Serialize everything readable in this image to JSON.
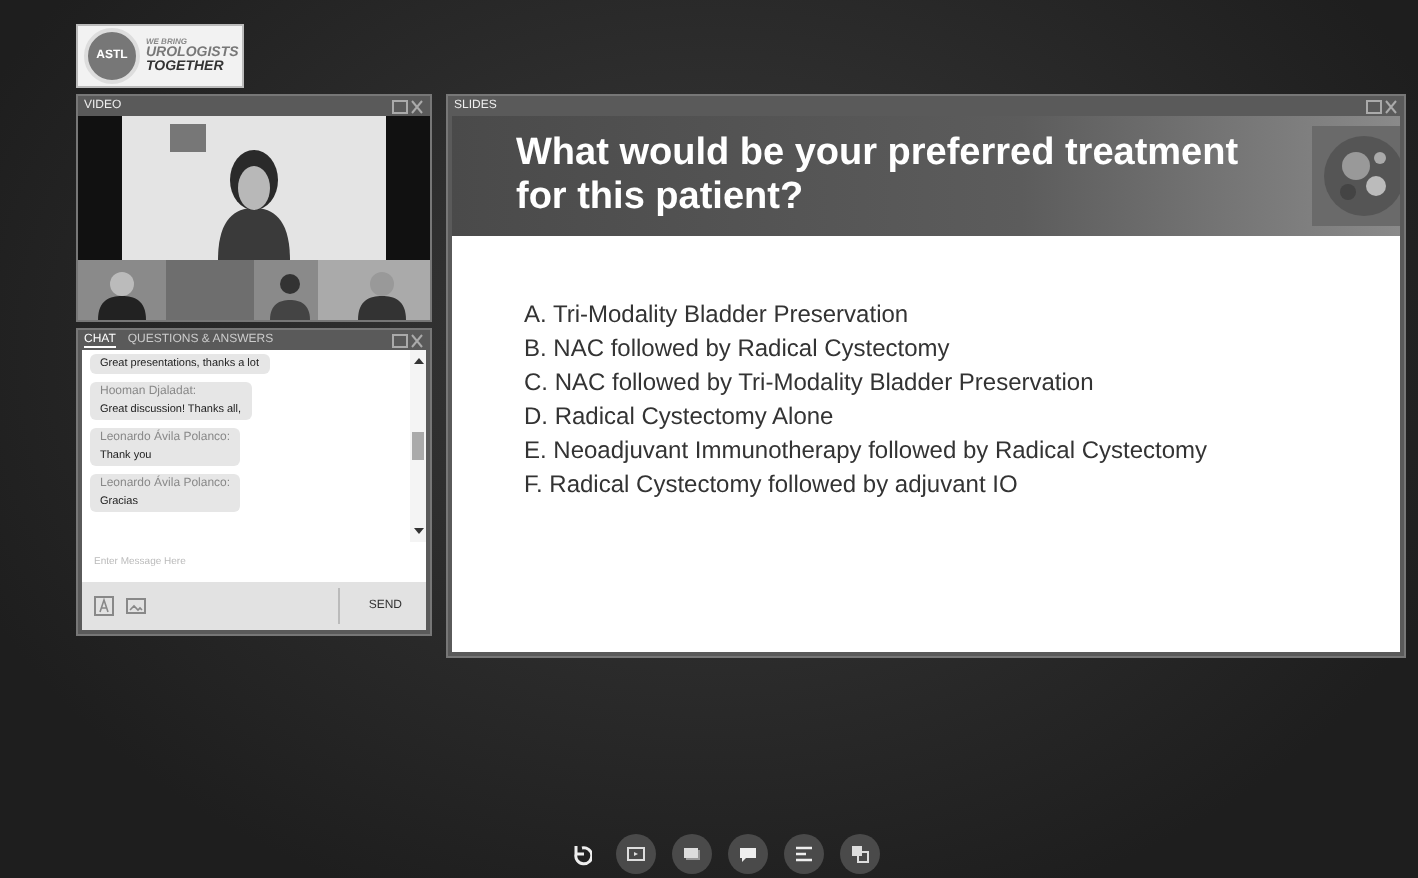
{
  "logo": {
    "tagline": "WE BRING",
    "line1": "UROLOGISTS",
    "line2": "TOGETHER",
    "badge": "ASTL"
  },
  "video": {
    "title": "VIDEO"
  },
  "chat": {
    "tabs": [
      {
        "label": "CHAT",
        "selected": true
      },
      {
        "label": "QUESTIONS & ANSWERS",
        "selected": false
      }
    ],
    "messages": [
      {
        "message": "Great presentations, thanks a lot"
      },
      {
        "author": "Hooman Djaladat:",
        "message": "Great discussion! Thanks all,"
      },
      {
        "author": "Leonardo Ávila Polanco:",
        "message": "Thank you"
      },
      {
        "author": "Leonardo Ávila Polanco:",
        "message": "Gracias"
      }
    ],
    "input": {
      "placeholder": "Enter Message Here"
    },
    "send": "SEND"
  },
  "slides": {
    "title": "SLIDES",
    "heading": "What would be your preferred treatment for this patient?",
    "options": [
      "A. Tri-Modality Bladder Preservation",
      "B. NAC followed by Radical Cystectomy",
      "C. NAC followed by Tri-Modality Bladder Preservation",
      "D. Radical Cystectomy Alone",
      "E. Neoadjuvant Immunotherapy followed by Radical Cystectomy",
      "F. Radical Cystectomy followed by adjuvant IO"
    ]
  },
  "toolbar": [
    {
      "kind": "refresh"
    },
    {
      "kind": "screen"
    },
    {
      "kind": "slides"
    },
    {
      "kind": "chat"
    },
    {
      "kind": "list"
    },
    {
      "kind": "translate"
    }
  ]
}
